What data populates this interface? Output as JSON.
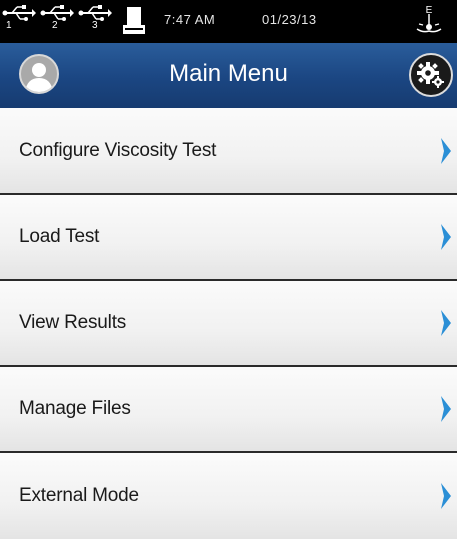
{
  "status_bar": {
    "usb_ports": [
      "1",
      "2",
      "3"
    ],
    "time": "7:47 AM",
    "date": "01/23/13",
    "icons": [
      "usb-icon",
      "usb-icon",
      "usb-icon",
      "printer-icon",
      "level-icon"
    ]
  },
  "header": {
    "title": "Main Menu",
    "left_icon": "user-avatar-icon",
    "right_icon": "settings-gear-icon",
    "background_color": "#1b4682"
  },
  "menu": {
    "items": [
      {
        "label": "Configure Viscosity Test",
        "icon": "chevron-right-icon"
      },
      {
        "label": "Load Test",
        "icon": "chevron-right-icon"
      },
      {
        "label": "View Results",
        "icon": "chevron-right-icon"
      },
      {
        "label": "Manage Files",
        "icon": "chevron-right-icon"
      },
      {
        "label": "External Mode",
        "icon": "chevron-right-icon"
      }
    ],
    "chevron_color": "#2b8fd6"
  }
}
